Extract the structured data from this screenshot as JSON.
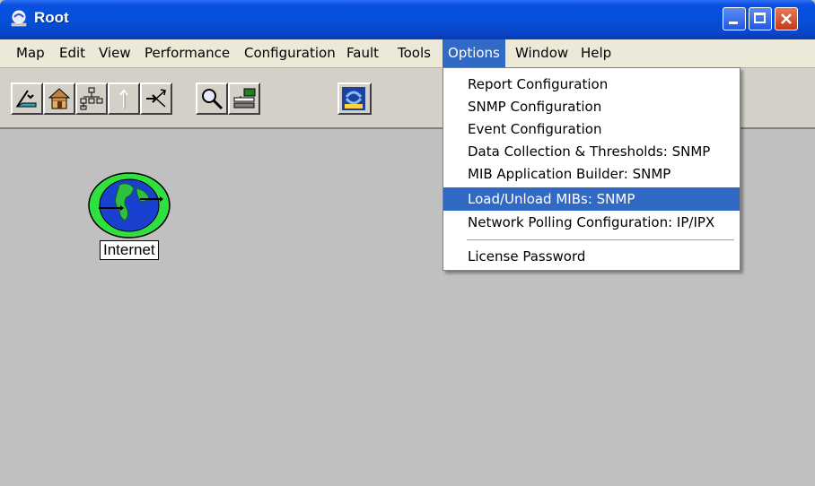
{
  "window": {
    "title": "Root"
  },
  "menubar": {
    "items": [
      "Map",
      "Edit",
      "View",
      "Performance",
      "Configuration",
      "Fault",
      "Tools",
      "Options",
      "Window",
      "Help"
    ],
    "active": "Options"
  },
  "toolbar": {
    "buttons": [
      "map-icon",
      "home-icon",
      "network-tree-icon",
      "up-arrow-icon",
      "connect-arrows-icon",
      "search-magnifier-icon",
      "server-icon",
      "hp-openview-icon"
    ]
  },
  "map": {
    "node_label": "Internet",
    "node_icon": "globe-icon"
  },
  "options_menu": {
    "items": [
      "Report Configuration",
      "SNMP Configuration",
      "Event Configuration",
      "Data Collection & Thresholds: SNMP",
      "MIB Application Builder: SNMP",
      "Load/Unload MIBs: SNMP",
      "Network Polling Configuration: IP/IPX"
    ],
    "highlighted": "Load/Unload MIBs: SNMP",
    "footer_item": "License Password"
  },
  "colors": {
    "titlebar": "#0550d8",
    "highlight": "#316ac5",
    "canvas": "#c0c0c0",
    "menubar": "#ece9d8"
  }
}
